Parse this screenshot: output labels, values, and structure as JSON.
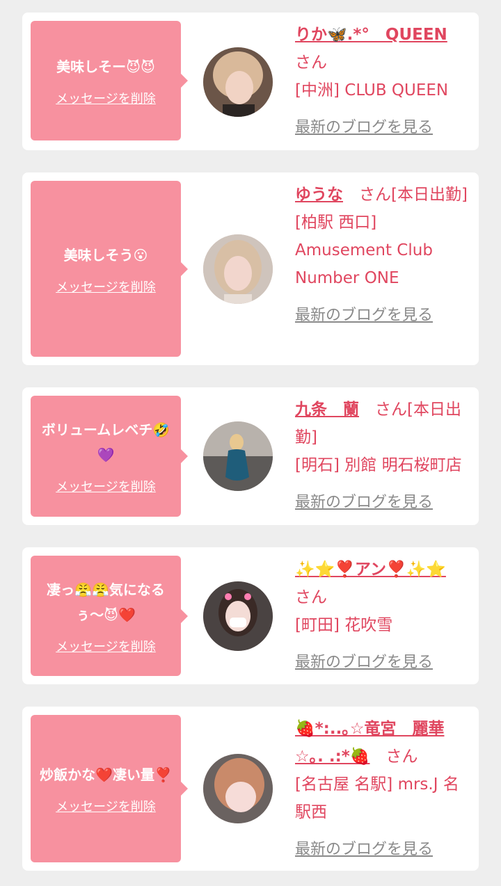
{
  "cards": [
    {
      "message": "美味しそー😈😈",
      "delete_label": "メッセージを削除",
      "name": "りか🦋.*°　QUEEN",
      "honorific": "さん",
      "shop": "[中洲] CLUB QUEEN",
      "blog_link": "最新のブログを見る",
      "avatar_icon": "avatar-photo"
    },
    {
      "message": "美味しそう😮",
      "delete_label": "メッセージを削除",
      "name": "ゆうな",
      "honorific": "さん[本日出勤]",
      "shop": "[柏駅 西口] Amusement Club Number ONE",
      "blog_link": "最新のブログを見る",
      "avatar_icon": "avatar-photo"
    },
    {
      "message": "ボリュームレベチ🤣💜",
      "delete_label": "メッセージを削除",
      "name": "九条　蘭",
      "honorific": "さん[本日出勤]",
      "shop": "[明石] 別館 明石桜町店",
      "blog_link": "最新のブログを見る",
      "avatar_icon": "avatar-photo"
    },
    {
      "message": "凄っ😤😤気になるぅ〜😈❤️",
      "delete_label": "メッセージを削除",
      "name": "✨⭐❣️アン❣️✨⭐",
      "honorific": "さん",
      "shop": "[町田] 花吹雪",
      "blog_link": "最新のブログを見る",
      "avatar_icon": "avatar-photo"
    },
    {
      "message": "炒飯かな❤️凄い量❣️",
      "delete_label": "メッセージを削除",
      "name": "🍓*:..｡☆竜宮　麗華☆｡. .:*🍓",
      "honorific": "さん",
      "shop": "[名古屋 名駅] mrs.J 名駅西",
      "blog_link": "最新のブログを見る",
      "avatar_icon": "avatar-photo"
    }
  ]
}
